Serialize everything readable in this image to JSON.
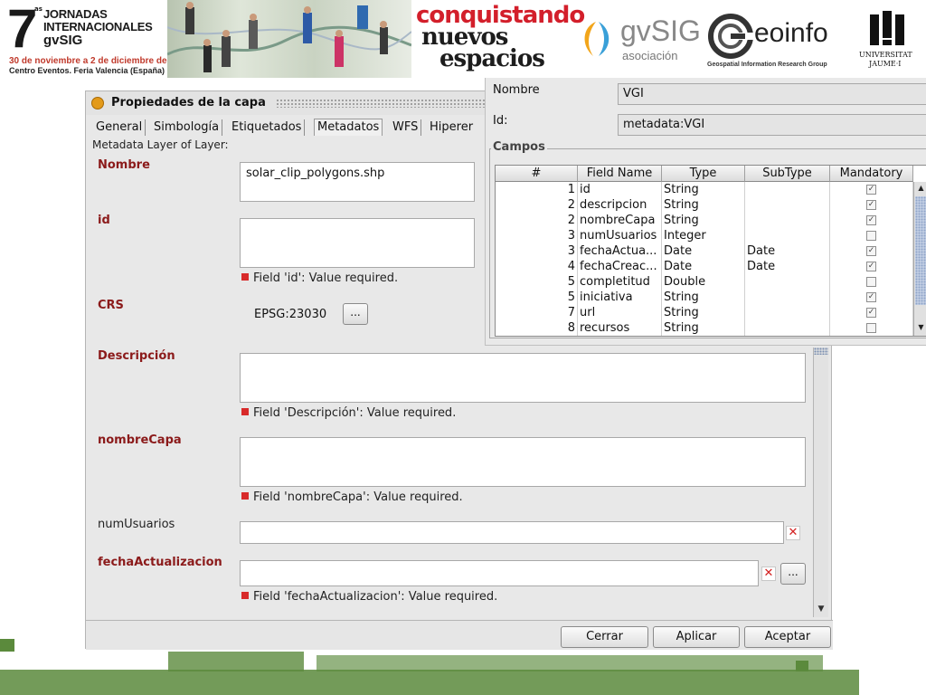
{
  "banner": {
    "edition_number": "7",
    "edition_suffix": "as",
    "jornadas_line1": "JORNADAS",
    "jornadas_line2": "INTERNACIONALES",
    "jornadas_line3": "gvSIG",
    "dates": "30 de noviembre a 2 de diciembre de 2011",
    "place": "Centro Eventos. Feria Valencia (España)",
    "slogan_line1": "conquistando",
    "slogan_line2": "nuevos",
    "slogan_line3": "espacios",
    "gvsig_name": "gvSIG",
    "gvsig_sub": "asociación",
    "geoinfo_name": "eoinfo",
    "geoinfo_sub": "Geospatial Information Research Group",
    "uji_line1": "UNIVERSITAT",
    "uji_line2": "JAUME·I"
  },
  "dialog": {
    "title": "Propiedades de la capa",
    "tabs": [
      "General",
      "Simbología",
      "Etiquetados",
      "Metadatos",
      "WFS",
      "Hiperer"
    ],
    "active_tab": "Metadatos",
    "metadata_heading": "Metadata Layer of Layer:",
    "fields": {
      "nombre": {
        "label": "Nombre",
        "value": "solar_clip_polygons.shp"
      },
      "id": {
        "label": "id",
        "value": "",
        "error": "Field 'id': Value required."
      },
      "crs": {
        "label": "CRS",
        "value": "EPSG:23030",
        "button": "..."
      },
      "descripcion": {
        "label": "Descripción",
        "value": "",
        "error": "Field 'Descripción': Value required."
      },
      "nombreCapa": {
        "label": "nombreCapa",
        "value": "",
        "error": "Field 'nombreCapa': Value required."
      },
      "numUsuarios": {
        "label": "numUsuarios",
        "value": ""
      },
      "fechaActualizacion": {
        "label": "fechaActualizacion",
        "value": "",
        "button": "...",
        "error": "Field 'fechaActualizacion': Value required."
      }
    },
    "buttons": {
      "close": "Cerrar",
      "apply": "Aplicar",
      "accept": "Aceptar"
    }
  },
  "schema_panel": {
    "nombre_label": "Nombre",
    "nombre_value": "VGI",
    "id_label": "Id:",
    "id_value": "metadata:VGI",
    "group_title": "Campos",
    "columns": [
      "#",
      "Field Name",
      "Type",
      "SubType",
      "Mandatory"
    ],
    "rows": [
      {
        "num": "1",
        "name": "id",
        "type": "String",
        "subtype": "",
        "mandatory": true
      },
      {
        "num": "2",
        "name": "descripcion",
        "type": "String",
        "subtype": "",
        "mandatory": true
      },
      {
        "num": "2",
        "name": "nombreCapa",
        "type": "String",
        "subtype": "",
        "mandatory": true
      },
      {
        "num": "3",
        "name": "numUsuarios",
        "type": "Integer",
        "subtype": "",
        "mandatory": false
      },
      {
        "num": "3",
        "name": "fechaActua...",
        "type": "Date",
        "subtype": "Date",
        "mandatory": true
      },
      {
        "num": "4",
        "name": "fechaCreac...",
        "type": "Date",
        "subtype": "Date",
        "mandatory": true
      },
      {
        "num": "5",
        "name": "completitud",
        "type": "Double",
        "subtype": "",
        "mandatory": false
      },
      {
        "num": "5",
        "name": "iniciativa",
        "type": "String",
        "subtype": "",
        "mandatory": true
      },
      {
        "num": "7",
        "name": "url",
        "type": "String",
        "subtype": "",
        "mandatory": true
      },
      {
        "num": "8",
        "name": "recursos",
        "type": "String",
        "subtype": "",
        "mandatory": false
      }
    ]
  },
  "icons": {
    "check": "✓",
    "clear": "✕",
    "error": "error-square-icon",
    "scroll_up": "▲",
    "scroll_down": "▼"
  },
  "colors": {
    "required_label": "#8b1a1a",
    "error_icon": "#d82a2a",
    "banner_accent": "#d31f2b",
    "bottom_green": "#5b8a3c"
  }
}
